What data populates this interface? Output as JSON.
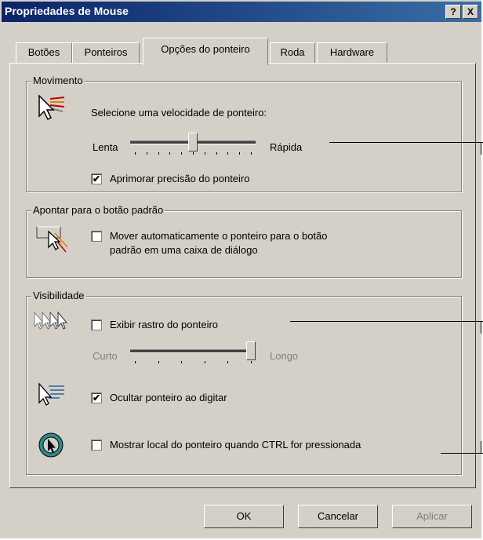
{
  "window": {
    "title": "Propriedades de Mouse",
    "help_btn": "?",
    "close_btn": "X"
  },
  "tabs": [
    {
      "label": "Botões"
    },
    {
      "label": "Ponteiros"
    },
    {
      "label": "Opções do ponteiro",
      "active": true
    },
    {
      "label": "Roda"
    },
    {
      "label": "Hardware"
    }
  ],
  "movimento": {
    "title": "Movimento",
    "icon": "pointer-speed-icon",
    "prompt": "Selecione uma velocidade de ponteiro:",
    "slow_label": "Lenta",
    "fast_label": "Rápida",
    "speed_level": 0.5,
    "enhance_label": "Aprimorar precisão do ponteiro",
    "enhance_checked": true
  },
  "snap": {
    "title": "Apontar para o botão padrão",
    "icon": "snap-to-button-icon",
    "label_line1": "Mover automaticamente o ponteiro para o botão",
    "label_line2": "padrão em uma caixa de diálogo",
    "checked": false
  },
  "visibilidade": {
    "title": "Visibilidade",
    "trails_icon": "pointer-trails-icon",
    "trails_label": "Exibir rastro do ponteiro",
    "trails_checked": false,
    "short_label": "Curto",
    "long_label": "Longo",
    "trails_level": 1.0,
    "hide_icon": "hide-pointer-icon",
    "hide_label": "Ocultar ponteiro ao digitar",
    "hide_checked": true,
    "ctrl_icon": "show-location-icon",
    "ctrl_label": "Mostrar local do ponteiro quando CTRL for pressionada",
    "ctrl_checked": false
  },
  "buttons": {
    "ok": "OK",
    "cancel": "Cancelar",
    "apply": "Aplicar"
  },
  "check_glyph": "✔"
}
